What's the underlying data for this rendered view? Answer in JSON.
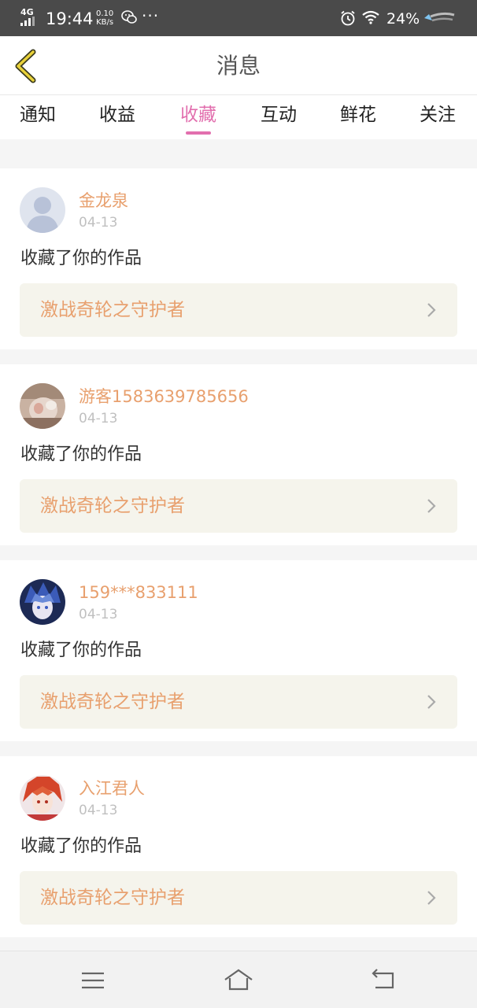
{
  "status_bar": {
    "network": "4G",
    "time": "19:44",
    "speed_value": "0.10",
    "speed_unit": "KB/s",
    "battery_percent": "24%",
    "icons": [
      "signal-icon",
      "wechat-icon",
      "more-dots-icon",
      "alarm-icon",
      "wifi-icon",
      "battery-icon"
    ]
  },
  "header": {
    "title": "消息",
    "back_icon": "chevron-left-icon",
    "accent_color": "#e8d13a"
  },
  "tabs": {
    "items": [
      "通知",
      "收益",
      "收藏",
      "互动",
      "鲜花",
      "关注"
    ],
    "active_index": 2,
    "active_color": "#e26fae"
  },
  "messages": [
    {
      "name": "金龙泉",
      "date": "04-13",
      "action": "收藏了你的作品",
      "work_title": "激战奇轮之守护者"
    },
    {
      "name": "游客1583639785656",
      "date": "04-13",
      "action": "收藏了你的作品",
      "work_title": "激战奇轮之守护者"
    },
    {
      "name": "159***833111",
      "date": "04-13",
      "action": "收藏了你的作品",
      "work_title": "激战奇轮之守护者"
    },
    {
      "name": "入江君人",
      "date": "04-13",
      "action": "收藏了你的作品",
      "work_title": "激战奇轮之守护者"
    }
  ],
  "colors": {
    "name_color": "#e8a06e",
    "work_bg": "#f5f4ec"
  },
  "nav_bar": {
    "icons": [
      "menu-icon",
      "home-icon",
      "back-icon"
    ]
  }
}
